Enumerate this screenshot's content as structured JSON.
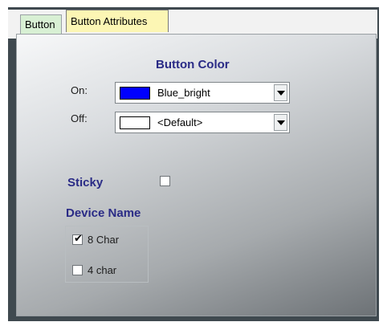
{
  "tabs": [
    {
      "label": "Button"
    },
    {
      "label": "Button Attributes"
    }
  ],
  "button_color": {
    "heading": "Button Color",
    "on": {
      "label": "On:",
      "value": "Blue_bright",
      "swatch": "#0000ff"
    },
    "off": {
      "label": "Off:",
      "value": "<Default>",
      "swatch": "#ffffff"
    }
  },
  "sticky": {
    "label": "Sticky",
    "checked": false
  },
  "device_name": {
    "heading": "Device Name",
    "options": [
      {
        "label": "8 Char",
        "checked": true
      },
      {
        "label": "4 char",
        "checked": false
      }
    ]
  },
  "colors": {
    "heading": "#2a2b86",
    "tab_active": "#fcf6b4",
    "tab_inactive": "#d8f0d4"
  },
  "icons": {
    "dropdown": "chevron-down-icon",
    "check": "check-icon"
  }
}
